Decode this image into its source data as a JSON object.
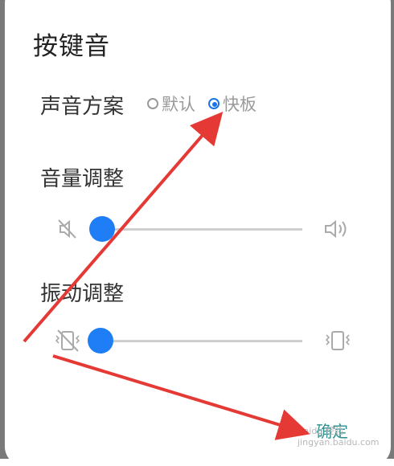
{
  "dialog": {
    "title": "按键音",
    "sound_scheme": {
      "label": "声音方案",
      "options": [
        {
          "label": "默认",
          "selected": false
        },
        {
          "label": "快板",
          "selected": true
        }
      ]
    },
    "volume": {
      "label": "音量调整",
      "value": 0,
      "min_icon": "volume-muted-icon",
      "max_icon": "volume-up-icon"
    },
    "vibration": {
      "label": "振动调整",
      "value": 0,
      "min_icon": "vibration-off-icon",
      "max_icon": "vibration-on-icon"
    },
    "confirm_label": "确定"
  },
  "watermark": {
    "line1": "Baidu 经验",
    "line2": "jingyan.baidu.com"
  },
  "colors": {
    "accent": "#1f7ef5",
    "annotation_arrow": "#e53935",
    "confirm_text": "#2f8f8f"
  }
}
